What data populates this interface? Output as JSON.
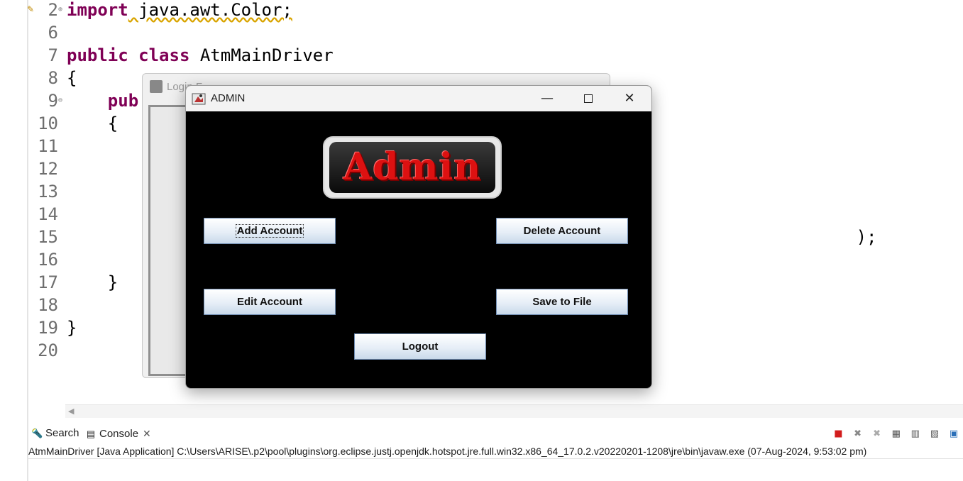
{
  "editor": {
    "lines": [
      {
        "num": "2",
        "fold": "⊕",
        "parts": [
          {
            "t": "import",
            "kw": true
          },
          {
            "t": " java.awt.Color;",
            "kw": false
          }
        ]
      },
      {
        "num": "6",
        "fold": "",
        "parts": []
      },
      {
        "num": "7",
        "fold": "",
        "parts": [
          {
            "t": "public",
            "kw": true
          },
          {
            "t": " ",
            "kw": false
          },
          {
            "t": "class",
            "kw": true
          },
          {
            "t": " AtmMainDriver",
            "kw": false
          }
        ]
      },
      {
        "num": "8",
        "fold": "",
        "parts": [
          {
            "t": "{",
            "kw": false
          }
        ]
      },
      {
        "num": "9",
        "fold": "⊖",
        "parts": [
          {
            "t": "    ",
            "kw": false
          },
          {
            "t": "pub",
            "kw": true
          }
        ]
      },
      {
        "num": "10",
        "fold": "",
        "parts": [
          {
            "t": "    {",
            "kw": false
          }
        ]
      },
      {
        "num": "11",
        "fold": "",
        "parts": []
      },
      {
        "num": "12",
        "fold": "",
        "parts": []
      },
      {
        "num": "13",
        "fold": "",
        "parts": []
      },
      {
        "num": "14",
        "fold": "",
        "parts": []
      },
      {
        "num": "15",
        "fold": "",
        "parts": [
          {
            "t": "                                                                             );",
            "kw": false
          }
        ]
      },
      {
        "num": "16",
        "fold": "",
        "parts": []
      },
      {
        "num": "17",
        "fold": "",
        "parts": [
          {
            "t": "    }",
            "kw": false
          }
        ]
      },
      {
        "num": "18",
        "fold": "",
        "parts": []
      },
      {
        "num": "19",
        "fold": "",
        "parts": [
          {
            "t": "}",
            "kw": false
          }
        ]
      },
      {
        "num": "20",
        "fold": "",
        "parts": []
      }
    ]
  },
  "login_window": {
    "title": "Login F"
  },
  "admin_window": {
    "title": "ADMIN",
    "logo_text": "Admin",
    "buttons": {
      "add_account": "Add Account",
      "delete_account": "Delete Account",
      "edit_account": "Edit Account",
      "save_to_file": "Save to File",
      "logout": "Logout"
    }
  },
  "console": {
    "tabs": {
      "search": "Search",
      "console": "Console"
    },
    "status": "AtmMainDriver [Java Application] C:\\Users\\ARISE\\.p2\\pool\\plugins\\org.eclipse.justj.openjdk.hotspot.jre.full.win32.x86_64_17.0.2.v20220201-1208\\jre\\bin\\javaw.exe  (07-Aug-2024, 9:53:02 pm)"
  }
}
